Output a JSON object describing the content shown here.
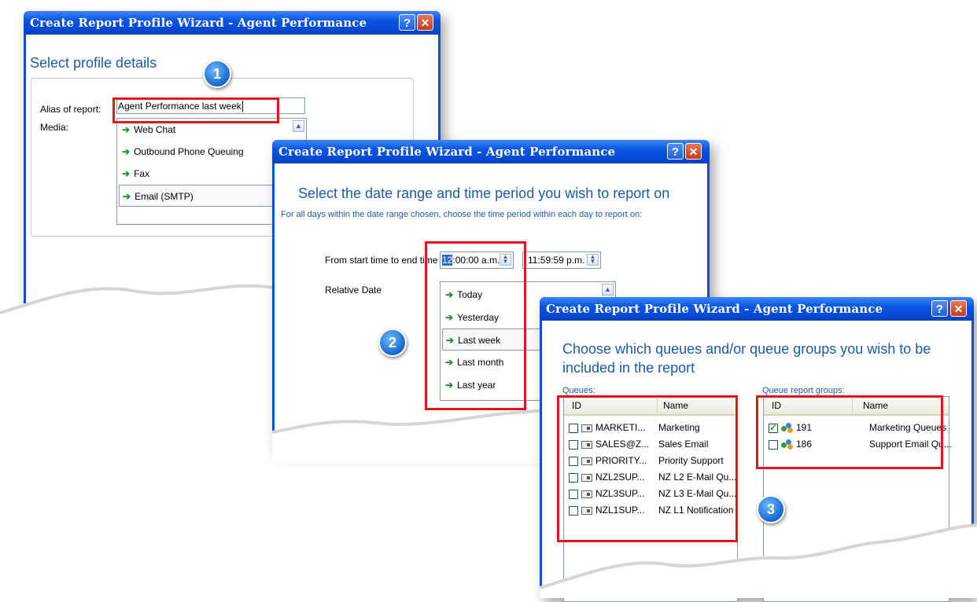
{
  "dialog1": {
    "title": "Create Report Profile Wizard - Agent Performance",
    "help": "?",
    "close": "✕",
    "heading": "Select profile details",
    "alias_label": "Alias of report:",
    "alias_value": "Agent Performance last week",
    "media_label": "Media:",
    "media_items": [
      "Web Chat",
      "Outbound Phone Queuing",
      "Fax",
      "Email (SMTP)"
    ],
    "scroll_up": "▲"
  },
  "dialog2": {
    "title": "Create Report Profile Wizard - Agent Performance",
    "help": "?",
    "close": "✕",
    "heading": "Select the date range and time period you wish to report on",
    "subtext": "For all days within the date range chosen, choose the time period within each day to report on:",
    "time_label": "From start time to end time",
    "start_time_hl": "12",
    "start_time_rest": ":00:00 a.m.",
    "end_time": "11:59:59 p.m.",
    "relative_label": "Relative Date",
    "relative_items": [
      "Today",
      "Yesterday",
      "Last week",
      "Last month",
      "Last year"
    ],
    "scroll_up": "▲"
  },
  "dialog3": {
    "title": "Create Report Profile Wizard - Agent Performance",
    "help": "?",
    "close": "✕",
    "heading_line1": "Choose which queues and/or queue groups you wish to be",
    "heading_line2": "included in the report",
    "queues_label": "Queues:",
    "groups_label": "Queue report groups:",
    "col_id": "ID",
    "col_name": "Name",
    "queues": [
      {
        "id": "MARKETI...",
        "name": "Marketing"
      },
      {
        "id": "SALES@Z...",
        "name": "Sales Email"
      },
      {
        "id": "PRIORITY...",
        "name": "Priority Support"
      },
      {
        "id": "NZL2SUP...",
        "name": "NZ L2 E-Mail Qu..."
      },
      {
        "id": "NZL3SUP...",
        "name": "NZ L3 E-Mail Qu..."
      },
      {
        "id": "NZL1SUP...",
        "name": "NZ L1 Notification"
      }
    ],
    "groups": [
      {
        "id": "191",
        "name": "Marketing Queues",
        "checked": true
      },
      {
        "id": "186",
        "name": "Support Email Qu...",
        "checked": false
      }
    ]
  },
  "badges": {
    "one": "1",
    "two": "2",
    "three": "3"
  },
  "colors": {
    "titlebar": "#0a55e4",
    "heading": "#1f5aa8",
    "highlight": "#e3161b",
    "arrow": "#1e8f2c"
  }
}
